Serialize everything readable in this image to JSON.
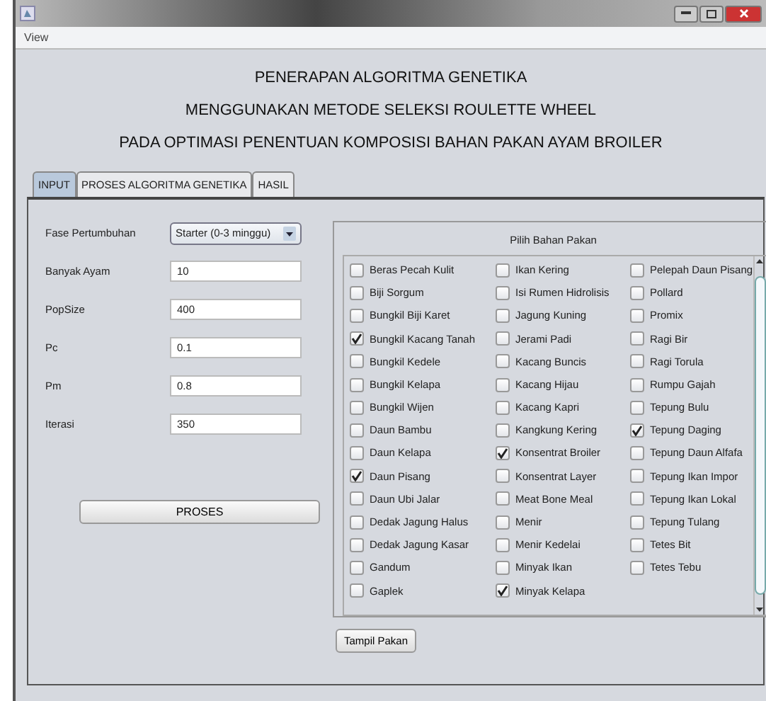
{
  "menu": [
    "View"
  ],
  "headings": [
    "PENERAPAN ALGORITMA GENETIKA",
    "MENGGUNAKAN METODE SELEKSI ROULETTE WHEEL",
    "PADA OPTIMASI PENENTUAN KOMPOSISI BAHAN PAKAN AYAM BROILER"
  ],
  "tabs": [
    {
      "label": "INPUT",
      "selected": true
    },
    {
      "label": "PROSES ALGORITMA GENETIKA",
      "selected": false
    },
    {
      "label": "HASIL",
      "selected": false
    }
  ],
  "form": [
    {
      "label": "Fase Pertumbuhan",
      "kind": "select",
      "value": "Starter  (0-3 minggu)"
    },
    {
      "label": "Banyak Ayam",
      "kind": "text",
      "value": "10"
    },
    {
      "label": "PopSize",
      "kind": "text",
      "value": "400"
    },
    {
      "label": "Pc",
      "kind": "text",
      "value": "0.1"
    },
    {
      "label": "Pm",
      "kind": "text",
      "value": "0.8"
    },
    {
      "label": "Iterasi",
      "kind": "text",
      "value": "350"
    }
  ],
  "process_button": "PROSES",
  "ingredients": {
    "title": "Pilih Bahan Pakan",
    "columns": [
      {
        "items": [
          {
            "label": "Beras Pecah Kulit",
            "checked": false
          },
          {
            "label": "Biji Sorgum",
            "checked": false
          },
          {
            "label": "Bungkil Biji Karet",
            "checked": false
          },
          {
            "label": "Bungkil Kacang Tanah",
            "checked": true
          },
          {
            "label": "Bungkil Kedele",
            "checked": false
          },
          {
            "label": "Bungkil Kelapa",
            "checked": false
          },
          {
            "label": "Bungkil Wijen",
            "checked": false
          },
          {
            "label": "Daun Bambu",
            "checked": false
          },
          {
            "label": "Daun Kelapa",
            "checked": false
          },
          {
            "label": "Daun Pisang",
            "checked": true
          },
          {
            "label": "Daun Ubi Jalar",
            "checked": false
          },
          {
            "label": "Dedak Jagung Halus",
            "checked": false
          },
          {
            "label": "Dedak Jagung Kasar",
            "checked": false
          },
          {
            "label": "Gandum",
            "checked": false
          },
          {
            "label": "Gaplek",
            "checked": false
          }
        ]
      },
      {
        "items": [
          {
            "label": "Ikan Kering",
            "checked": false
          },
          {
            "label": "Isi Rumen Hidrolisis",
            "checked": false
          },
          {
            "label": "Jagung Kuning",
            "checked": false
          },
          {
            "label": "Jerami Padi",
            "checked": false
          },
          {
            "label": "Kacang Buncis",
            "checked": false
          },
          {
            "label": "Kacang Hijau",
            "checked": false
          },
          {
            "label": "Kacang Kapri",
            "checked": false
          },
          {
            "label": "Kangkung Kering",
            "checked": false
          },
          {
            "label": "Konsentrat Broiler",
            "checked": true
          },
          {
            "label": "Konsentrat Layer",
            "checked": false
          },
          {
            "label": "Meat Bone Meal",
            "checked": false
          },
          {
            "label": "Menir",
            "checked": false
          },
          {
            "label": "Menir Kedelai",
            "checked": false
          },
          {
            "label": "Minyak Ikan",
            "checked": false
          },
          {
            "label": "Minyak Kelapa",
            "checked": true
          }
        ]
      },
      {
        "items": [
          {
            "label": "Pelepah Daun Pisang",
            "checked": false
          },
          {
            "label": "Pollard",
            "checked": false
          },
          {
            "label": "Promix",
            "checked": false
          },
          {
            "label": "Ragi Bir",
            "checked": false
          },
          {
            "label": "Ragi Torula",
            "checked": false
          },
          {
            "label": "Rumpu Gajah",
            "checked": false
          },
          {
            "label": "Tepung Bulu",
            "checked": false
          },
          {
            "label": "Tepung Daging",
            "checked": true
          },
          {
            "label": "Tepung Daun Alfafa",
            "checked": false
          },
          {
            "label": "Tepung Ikan Impor",
            "checked": false
          },
          {
            "label": "Tepung Ikan Lokal",
            "checked": false
          },
          {
            "label": "Tepung Tulang",
            "checked": false
          },
          {
            "label": "Tetes Bit",
            "checked": false
          },
          {
            "label": "Tetes Tebu",
            "checked": false
          }
        ]
      }
    ]
  },
  "show_button": "Tampil Pakan"
}
